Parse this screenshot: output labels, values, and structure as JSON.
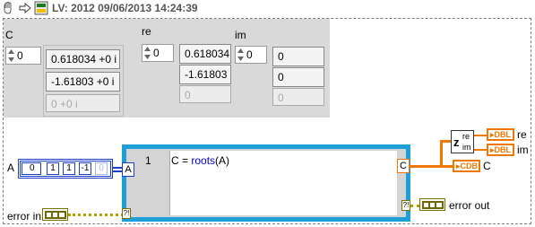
{
  "header": {
    "title": "LV: 2012 09/06/2013 14:24:39"
  },
  "front_panel": {
    "c_label": "C",
    "c_index": "0",
    "c_values": [
      "0.618034 +0 i",
      "-1.61803 +0 i",
      "0 +0 i"
    ],
    "re_label": "re",
    "re_index": "0",
    "re_values": [
      "0.618034",
      "-1.61803",
      "0"
    ],
    "im_label": "im",
    "im_index": "0",
    "im_values": [
      "0",
      "0",
      "0"
    ]
  },
  "diagram": {
    "a_label": "A",
    "a_index": "0",
    "a_values": [
      "1",
      "1",
      "-1",
      "0"
    ],
    "script_line_number": "1",
    "script_code_prefix": "C = ",
    "script_code_func": "roots",
    "script_code_suffix": "(A)",
    "input_terminal": "A",
    "output_terminal": "C",
    "re_label": "re",
    "im_label": "im",
    "c_label": "C",
    "dbl_text": "DBL",
    "cdb_text": "CDB",
    "error_in": "error in",
    "error_out": "error out",
    "complex_z": "z",
    "complex_re": "re",
    "complex_im": "im"
  },
  "colors": {
    "script_border": "#1e9fd8",
    "array_blue": "#1a3fc8",
    "complex_orange": "#f07800",
    "error_wire": "#b0a000"
  }
}
